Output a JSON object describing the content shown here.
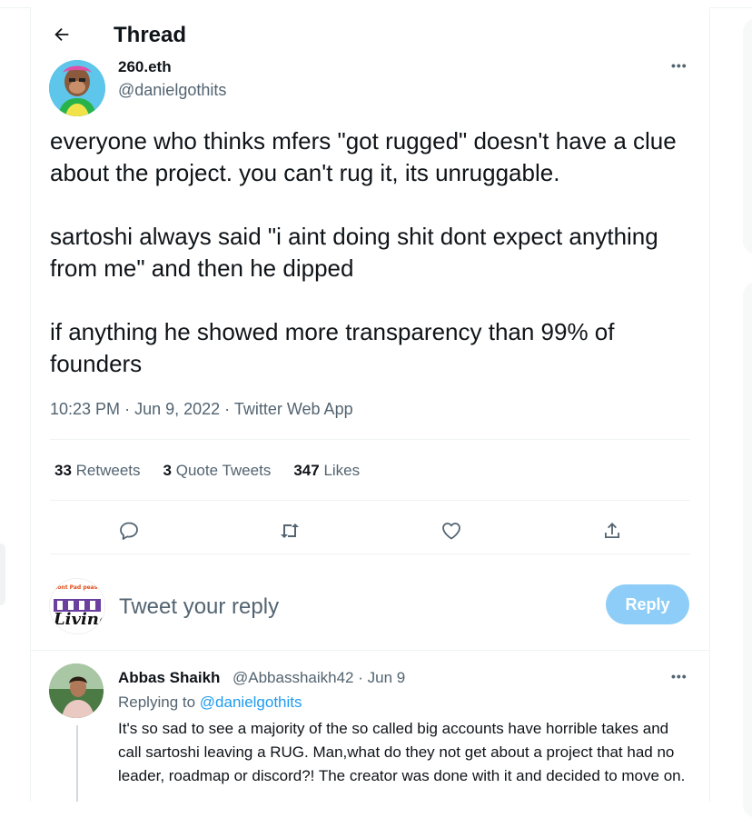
{
  "header": {
    "title": "Thread"
  },
  "tweet": {
    "author_name": "260.eth",
    "author_handle": "@danielgothits",
    "more": "•••",
    "paragraphs": [
      "everyone who thinks mfers \"got rugged\" doesn't have a clue about the project. you can't rug it, its unruggable.",
      "sartoshi always said \"i aint doing shit dont expect anything from me\" and then he dipped",
      "if anything he showed more transparency than 99% of founders"
    ],
    "time": "10:23 PM",
    "sep": "·",
    "date": "Jun 9, 2022",
    "source": "Twitter Web App",
    "stats": {
      "retweets_count": "33",
      "retweets_label": "Retweets",
      "quotes_count": "3",
      "quotes_label": "Quote Tweets",
      "likes_count": "347",
      "likes_label": "Likes"
    }
  },
  "reply_box": {
    "placeholder": "Tweet your reply",
    "button": "Reply",
    "avatar_text_top": "dont Pad pease",
    "avatar_text_main": "Living"
  },
  "reply": {
    "name": "Abbas Shaikh",
    "handle_date": "@Abbasshaikh42 · Jun 9",
    "replying_prefix": "Replying to",
    "replying_to": "@danielgothits",
    "more": "•••",
    "text": "It's so sad to see a majority of the so called big accounts have horrible takes and call sartoshi leaving a RUG. Man,what do they not get about a project that had no leader, roadmap or discord?! The creator was done with it and decided to move on."
  },
  "colors": {
    "accent": "#1d9bf0",
    "reply_button": "#8ecdf7",
    "muted": "#536471"
  }
}
